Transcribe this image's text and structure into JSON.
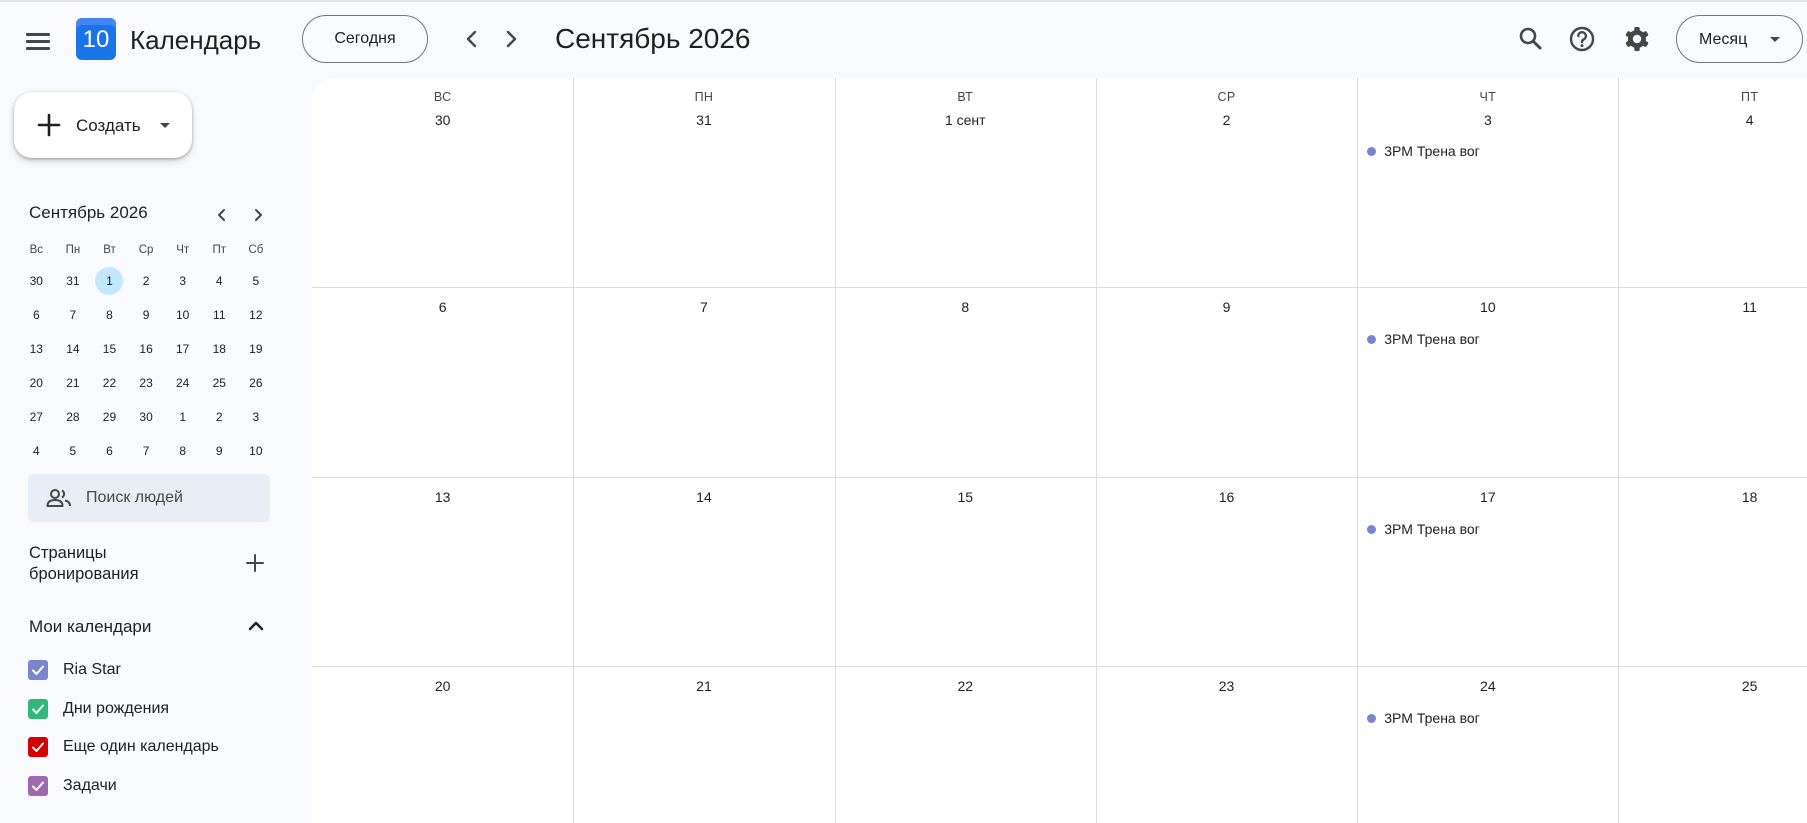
{
  "header": {
    "app_title": "Календарь",
    "logo_day": "10",
    "today_label": "Сегодня",
    "period_title": "Сентябрь 2026",
    "view_label": "Месяц",
    "icons": [
      "menu-icon",
      "chevron-left-icon",
      "chevron-right-icon",
      "search-icon",
      "help-icon",
      "settings-icon"
    ]
  },
  "sidebar": {
    "create_label": "Создать",
    "mini_calendar": {
      "title": "Сентябрь 2026",
      "weekdays": [
        "Вс",
        "Пн",
        "Вт",
        "Ср",
        "Чт",
        "Пт",
        "Сб"
      ],
      "weeks": [
        [
          "30",
          "31",
          "1",
          "2",
          "3",
          "4",
          "5"
        ],
        [
          "6",
          "7",
          "8",
          "9",
          "10",
          "11",
          "12"
        ],
        [
          "13",
          "14",
          "15",
          "16",
          "17",
          "18",
          "19"
        ],
        [
          "20",
          "21",
          "22",
          "23",
          "24",
          "25",
          "26"
        ],
        [
          "27",
          "28",
          "29",
          "30",
          "1",
          "2",
          "3"
        ],
        [
          "4",
          "5",
          "6",
          "7",
          "8",
          "9",
          "10"
        ]
      ],
      "highlighted": "1"
    },
    "people_search_placeholder": "Поиск людей",
    "booking_pages_title": "Страницы бронирования",
    "my_calendars_title": "Мои календари",
    "calendars": [
      {
        "name": "Ria Star",
        "color": "#7986cb"
      },
      {
        "name": "Дни рождения",
        "color": "#33b679"
      },
      {
        "name": "Еще один календарь",
        "color": "#d50000"
      },
      {
        "name": "Задачи",
        "color": "#9e69af"
      }
    ]
  },
  "month_grid": {
    "weekday_headers": [
      "ВС",
      "ПН",
      "ВТ",
      "СР",
      "ЧТ",
      "ПТ"
    ],
    "weeks": [
      [
        "30",
        "31",
        "1 сент",
        "2",
        "3",
        "4"
      ],
      [
        "6",
        "7",
        "8",
        "9",
        "10",
        "11"
      ],
      [
        "13",
        "14",
        "15",
        "16",
        "17",
        "18"
      ],
      [
        "20",
        "21",
        "22",
        "23",
        "24",
        "25"
      ]
    ],
    "events": [
      {
        "week": 0,
        "day": 4,
        "title": "3PM Трена вог",
        "color": "#7986cb"
      },
      {
        "week": 1,
        "day": 4,
        "title": "3PM Трена вог",
        "color": "#7986cb"
      },
      {
        "week": 2,
        "day": 4,
        "title": "3PM Трена вог",
        "color": "#7986cb"
      },
      {
        "week": 3,
        "day": 4,
        "title": "3PM Трена вог",
        "color": "#7986cb"
      }
    ]
  }
}
